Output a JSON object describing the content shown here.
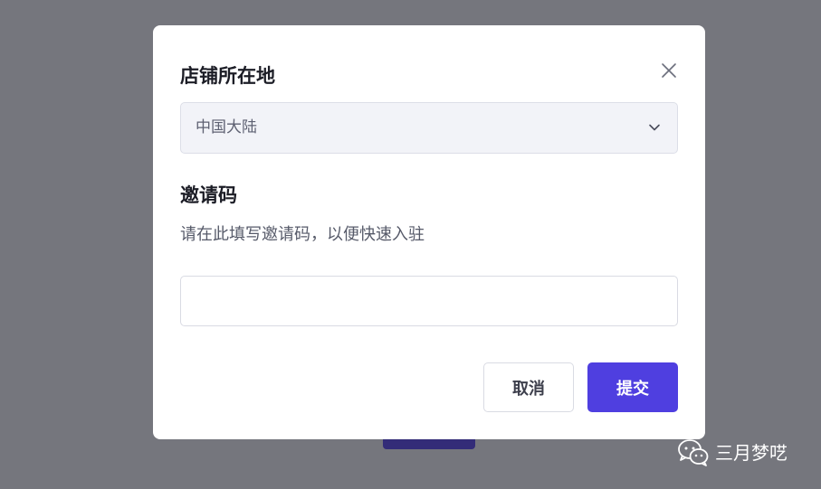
{
  "dialog": {
    "region_title": "店铺所在地",
    "region_select": {
      "value": "中国大陆"
    },
    "invite_title": "邀请码",
    "invite_help": "请在此填写邀请码，以便快速入驻",
    "invite_input": {
      "value": "",
      "placeholder": ""
    },
    "cancel_label": "取消",
    "submit_label": "提交"
  },
  "watermark": {
    "text": "三月梦呓",
    "icon": "wechat-icon"
  },
  "colors": {
    "overlay": "#75767d",
    "primary": "#4f3fe0",
    "select_bg": "#f2f3f8",
    "title_text": "#1c1d26"
  },
  "icons": {
    "close": "close-icon",
    "dropdown": "chevron-down-icon"
  }
}
